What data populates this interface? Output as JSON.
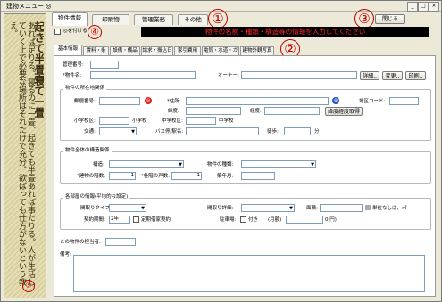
{
  "window": {
    "title": "建物メニュー ◎",
    "min": "_",
    "max": "□",
    "close": "×"
  },
  "sidebar": {
    "title": "起きて半畳寝て一畳",
    "poem": "あれば足りる。寝るのに一畳、起きても半畳あれば事たりる。人が生活していく上で必要な場所はそれだけで充分。欲ばっても仕方がないという教え。",
    "marker": "⑤"
  },
  "top_tabs": [
    {
      "label": "物件情報"
    },
    {
      "label": "印刷物"
    },
    {
      "label": "管理業務"
    },
    {
      "label": "その他"
    }
  ],
  "markers": {
    "m1": "①",
    "m2": "②",
    "m3": "③",
    "m4": "④"
  },
  "close_button": "閉じる",
  "banner": "物件の名前・種類・構造等の情報を入力してください",
  "check_label": "◎を付ける",
  "sub_tabs": [
    {
      "label": "基本情報"
    },
    {
      "label": "賃料・条件"
    },
    {
      "label": "設備・備品"
    },
    {
      "label": "請求・振込日"
    },
    {
      "label": "家引費用"
    },
    {
      "label": "電気・水道・ガス"
    },
    {
      "label": "建物外観写真"
    }
  ],
  "basic": {
    "kanri_no_label": "管理番号:",
    "name_label": "*物件名:",
    "owner_label": "オーナー:",
    "detail_btn": "詳細..",
    "change_btn": "変更..",
    "print_btn": "印刷.."
  },
  "location": {
    "group_label": "物件の所在地関係",
    "zip_label": "郵便番号:",
    "address_label": "*住所:",
    "district_label": "地区コード:",
    "lat_label": "緯度:",
    "lng_label": "経度:",
    "geo_btn": "緯度経度取得",
    "elem_label": "小学校区:",
    "elem_suffix": "小学校",
    "middle_label": "中学校区:",
    "middle_suffix": "中学校",
    "transport_label": "交通:",
    "bus_label": "バス停/駅名:",
    "walk_label": "徒歩:",
    "walk_unit": "分"
  },
  "structure": {
    "group_label": "物件全体の構造関係",
    "struct_label": "構造:",
    "kind_label": "物件の種類:",
    "floors_label": "*建物の階数:",
    "floors_value": "1",
    "units_label": "*各階の戸数:",
    "units_value": "1",
    "year_label": "築年月:"
  },
  "rooms": {
    "group_label": "各部屋の情報(平均的な設定)",
    "type_label": "間取りタイプ:",
    "detail_label": "間取り詳細:",
    "area_label": "面積:",
    "unit_label": "単位なしは、㎡",
    "period_label": "契約期間:",
    "period_value": "2年",
    "fixed_label": "定期借家契約",
    "parking_label": "駐車場:",
    "parking_opt": "付き",
    "monthly_label": "(月額)",
    "yen": "0 円)"
  },
  "manager_label": "この物件の担当者:",
  "notes_label": "備考:"
}
